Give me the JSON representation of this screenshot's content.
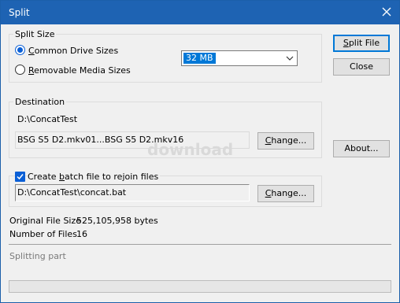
{
  "window": {
    "title": "Split"
  },
  "split_size": {
    "group_label": "Split Size",
    "common_drive_sizes": {
      "prefix": "C",
      "rest": "ommon Drive Sizes",
      "checked": true
    },
    "removable_media_sizes": {
      "prefix": "R",
      "rest": "emovable Media Sizes",
      "checked": false
    },
    "size_select": {
      "selected": "32 MB"
    }
  },
  "buttons": {
    "split_file": {
      "prefix": "S",
      "rest": "plit File"
    },
    "close": "Close",
    "about": "About...",
    "change_destination": {
      "prefix": "C",
      "rest": "hange..."
    },
    "change_batch": {
      "prefix": "C",
      "rest": "hange..."
    }
  },
  "destination": {
    "group_label": "Destination",
    "path": "D:\\ConcatTest",
    "files": "BSG S5 D2.mkv01...BSG S5 D2.mkv16"
  },
  "batch": {
    "checkbox": {
      "before": "Create ",
      "underline": "b",
      "after": "atch file to rejoin files",
      "checked": true
    },
    "path": "D:\\ConcatTest\\concat.bat"
  },
  "info": {
    "original_file_size_label": "Original File Size",
    "original_file_size_value": "525,105,958 bytes",
    "number_of_files_label": "Number of Files",
    "number_of_files_value": "16"
  },
  "status": {
    "text": "Splitting part",
    "progress": 0
  },
  "watermark": "download",
  "icons": {
    "close": "close-icon",
    "dropdown": "chevron-down-icon",
    "check": "check-icon"
  }
}
